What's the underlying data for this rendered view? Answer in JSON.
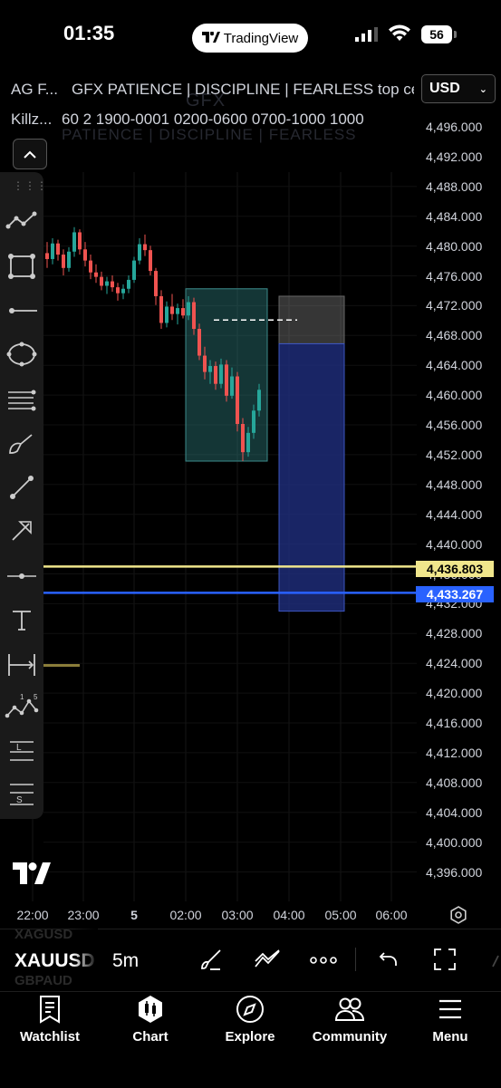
{
  "status": {
    "time": "01:35",
    "battery": "56"
  },
  "app": {
    "pill_label": "TradingView"
  },
  "header": {
    "symbol_short": "AG F...",
    "indicator_title": "GFX PATIENCE | DISCIPLINE | FEARLESS top ce",
    "killzone_short": "Killz...",
    "killzone_params": "60 2 1900-0001 0200-0600 0700-1000 1000",
    "currency": "USD",
    "watermark_top": "GFX",
    "watermark_bottom": "PATIENCE | DISCIPLINE | FEARLESS"
  },
  "price_axis": {
    "labels": [
      "4,496.000",
      "4,492.000",
      "4,488.000",
      "4,484.000",
      "4,480.000",
      "4,476.000",
      "4,472.000",
      "4,468.000",
      "4,464.000",
      "4,460.000",
      "4,456.000",
      "4,452.000",
      "4,448.000",
      "4,444.000",
      "4,440.000",
      "4,436.000",
      "4,432.000",
      "4,428.000",
      "4,424.000",
      "4,420.000",
      "4,416.000",
      "4,412.000",
      "4,408.000",
      "4,404.000",
      "4,400.000",
      "4,396.000"
    ],
    "yellow_tag": "4,436.803",
    "blue_tag": "4,433.267",
    "yellow_color": "#f0e68c",
    "blue_color": "#2962ff"
  },
  "time_axis": {
    "labels": [
      "22:00",
      "23:00",
      "5",
      "02:00",
      "03:00",
      "04:00",
      "05:00",
      "06:00"
    ]
  },
  "symbol_bar": {
    "symbol": "XAUUSD",
    "interval": "5m",
    "shadow_above": "XAGUSD",
    "shadow_below": "GBPAUD"
  },
  "bottom_nav": [
    {
      "label": "Watchlist",
      "icon": "watchlist-icon"
    },
    {
      "label": "Chart",
      "icon": "chart-icon"
    },
    {
      "label": "Explore",
      "icon": "explore-icon"
    },
    {
      "label": "Community",
      "icon": "community-icon"
    },
    {
      "label": "Menu",
      "icon": "menu-icon"
    }
  ],
  "chart_data": {
    "type": "candlestick",
    "symbol": "XAUUSD",
    "interval": "5m",
    "ylim": [
      4394.0,
      4498.0
    ],
    "candles": [
      {
        "t": "22:35",
        "o": 4479.0,
        "h": 4480.5,
        "l": 4477.0,
        "c": 4478.2
      },
      {
        "t": "22:40",
        "o": 4478.2,
        "h": 4481.0,
        "l": 4477.5,
        "c": 4480.3
      },
      {
        "t": "22:45",
        "o": 4480.3,
        "h": 4480.8,
        "l": 4478.0,
        "c": 4478.8
      },
      {
        "t": "22:50",
        "o": 4478.8,
        "h": 4479.5,
        "l": 4476.0,
        "c": 4477.0
      },
      {
        "t": "22:55",
        "o": 4477.0,
        "h": 4479.8,
        "l": 4476.5,
        "c": 4479.2
      },
      {
        "t": "23:00",
        "o": 4479.2,
        "h": 4482.5,
        "l": 4478.5,
        "c": 4481.8
      },
      {
        "t": "23:05",
        "o": 4481.8,
        "h": 4482.2,
        "l": 4478.8,
        "c": 4479.5
      },
      {
        "t": "23:10",
        "o": 4479.5,
        "h": 4480.5,
        "l": 4477.2,
        "c": 4478.0
      },
      {
        "t": "23:15",
        "o": 4478.0,
        "h": 4478.8,
        "l": 4475.5,
        "c": 4476.4
      },
      {
        "t": "23:20",
        "o": 4476.4,
        "h": 4477.5,
        "l": 4475.0,
        "c": 4475.8
      },
      {
        "t": "23:25",
        "o": 4475.8,
        "h": 4476.5,
        "l": 4474.0,
        "c": 4474.6
      },
      {
        "t": "23:30",
        "o": 4474.6,
        "h": 4475.8,
        "l": 4473.5,
        "c": 4475.2
      },
      {
        "t": "23:35",
        "o": 4475.2,
        "h": 4476.0,
        "l": 4473.8,
        "c": 4474.4
      },
      {
        "t": "23:40",
        "o": 4474.4,
        "h": 4475.0,
        "l": 4472.6,
        "c": 4473.6
      },
      {
        "t": "23:45",
        "o": 4473.6,
        "h": 4474.8,
        "l": 4472.8,
        "c": 4474.2
      },
      {
        "t": "23:50",
        "o": 4474.2,
        "h": 4476.0,
        "l": 4473.6,
        "c": 4475.4
      },
      {
        "t": "23:55",
        "o": 4475.4,
        "h": 4478.5,
        "l": 4475.0,
        "c": 4478.0
      },
      {
        "t": "00:00",
        "o": 4478.0,
        "h": 4481.0,
        "l": 4477.5,
        "c": 4480.2
      },
      {
        "t": "00:05",
        "o": 4480.2,
        "h": 4481.5,
        "l": 4478.6,
        "c": 4479.4
      },
      {
        "t": "00:10",
        "o": 4479.4,
        "h": 4480.0,
        "l": 4476.0,
        "c": 4476.6
      },
      {
        "t": "00:15",
        "o": 4476.6,
        "h": 4477.0,
        "l": 4472.0,
        "c": 4473.2
      },
      {
        "t": "00:20",
        "o": 4473.2,
        "h": 4474.0,
        "l": 4468.8,
        "c": 4469.6
      },
      {
        "t": "00:25",
        "o": 4469.6,
        "h": 4472.5,
        "l": 4469.0,
        "c": 4471.8
      },
      {
        "t": "00:30",
        "o": 4471.8,
        "h": 4473.5,
        "l": 4470.0,
        "c": 4470.8
      },
      {
        "t": "00:35",
        "o": 4470.8,
        "h": 4472.2,
        "l": 4469.4,
        "c": 4471.6
      },
      {
        "t": "00:40",
        "o": 4471.6,
        "h": 4472.8,
        "l": 4470.2,
        "c": 4470.6
      },
      {
        "t": "00:45",
        "o": 4470.6,
        "h": 4473.2,
        "l": 4470.0,
        "c": 4472.4
      },
      {
        "t": "00:50",
        "o": 4472.4,
        "h": 4473.0,
        "l": 4468.0,
        "c": 4468.8
      },
      {
        "t": "00:55",
        "o": 4468.8,
        "h": 4469.5,
        "l": 4464.6,
        "c": 4465.2
      },
      {
        "t": "01:00",
        "o": 4465.2,
        "h": 4466.4,
        "l": 4462.0,
        "c": 4463.0
      },
      {
        "t": "01:05",
        "o": 4463.0,
        "h": 4464.6,
        "l": 4461.4,
        "c": 4463.8
      },
      {
        "t": "01:10",
        "o": 4463.8,
        "h": 4464.4,
        "l": 4460.6,
        "c": 4461.4
      },
      {
        "t": "01:15",
        "o": 4461.4,
        "h": 4464.8,
        "l": 4460.8,
        "c": 4464.0
      },
      {
        "t": "01:20",
        "o": 4464.0,
        "h": 4464.6,
        "l": 4459.0,
        "c": 4459.8
      },
      {
        "t": "01:25",
        "o": 4459.8,
        "h": 4463.6,
        "l": 4459.4,
        "c": 4462.4
      },
      {
        "t": "01:30",
        "o": 4462.4,
        "h": 4463.0,
        "l": 4455.0,
        "c": 4456.0
      },
      {
        "t": "01:35",
        "o": 4456.0,
        "h": 4456.8,
        "l": 4451.0,
        "c": 4452.2
      },
      {
        "t": "01:40",
        "o": 4452.2,
        "h": 4455.6,
        "l": 4451.6,
        "c": 4454.8
      },
      {
        "t": "01:45",
        "o": 4454.8,
        "h": 4458.6,
        "l": 4454.0,
        "c": 4457.8
      },
      {
        "t": "01:50",
        "o": 4457.8,
        "h": 4461.4,
        "l": 4457.0,
        "c": 4460.6
      }
    ],
    "horizontal_lines": [
      {
        "price": 4436.803,
        "color": "#f0e68c"
      },
      {
        "price": 4433.267,
        "color": "#2962ff"
      }
    ]
  }
}
